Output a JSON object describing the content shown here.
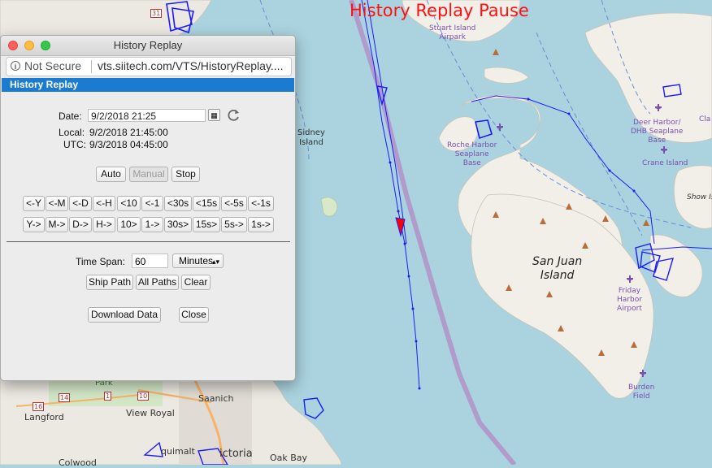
{
  "status_banner": "History Replay Pause",
  "map": {
    "labels": [
      {
        "text": "Sidney\nIsland"
      },
      {
        "text": "San Juan\nIsland"
      },
      {
        "text": "Saanich"
      },
      {
        "text": "View Royal"
      },
      {
        "text": "Langford"
      },
      {
        "text": "Oak Bay"
      },
      {
        "text": "Colwood"
      },
      {
        "text": "quimalt"
      },
      {
        "text": "ictoria"
      },
      {
        "text": "Park"
      }
    ],
    "pois": [
      {
        "text": "Stuart Island\nAirpark"
      },
      {
        "text": "Roche Harbor\nSeaplane\nBase"
      },
      {
        "text": "Deer Harbor/\nDHB Seaplane\nBase"
      },
      {
        "text": "Crane Island"
      },
      {
        "text": "Show Is"
      },
      {
        "text": "Friday\nHarbor\nAirport"
      },
      {
        "text": "Burden\nField"
      },
      {
        "text": "Cla"
      }
    ],
    "road_numbers": [
      "31",
      "16",
      "14",
      "1",
      "10"
    ]
  },
  "window": {
    "title": "History Replay",
    "url_security": "Not Secure",
    "url": "vts.siitech.com/VTS/HistoryReplay....",
    "panel_header": "History Replay",
    "date_label": "Date:",
    "date_value": "9/2/2018 21:25",
    "local_label": "Local:",
    "local_value": "9/2/2018 21:45:00",
    "utc_label": "UTC:",
    "utc_value": "9/3/2018 04:45:00",
    "mode_buttons": [
      "Auto",
      "Manual",
      "Stop"
    ],
    "back_buttons": [
      "<-Y",
      "<-M",
      "<-D",
      "<-H",
      "<10",
      "<-1",
      "<30s",
      "<15s",
      "<-5s",
      "<-1s"
    ],
    "fwd_buttons": [
      "Y->",
      "M->",
      "D->",
      "H->",
      "10>",
      "1->",
      "30s>",
      "15s>",
      "5s->",
      "1s->"
    ],
    "timespan_label": "Time Span:",
    "timespan_value": "60",
    "timespan_unit": "Minutes",
    "path_buttons": [
      "Ship Path",
      "All Paths",
      "Clear"
    ],
    "download_button": "Download Data",
    "close_button": "Close"
  },
  "colors": {
    "track": "#1a1aff",
    "vessel_highlight": "#ff0000",
    "banner": "#ff1111",
    "panel_header": "#1b7bd1",
    "water": "#aad3df",
    "land": "#f2efe9"
  }
}
